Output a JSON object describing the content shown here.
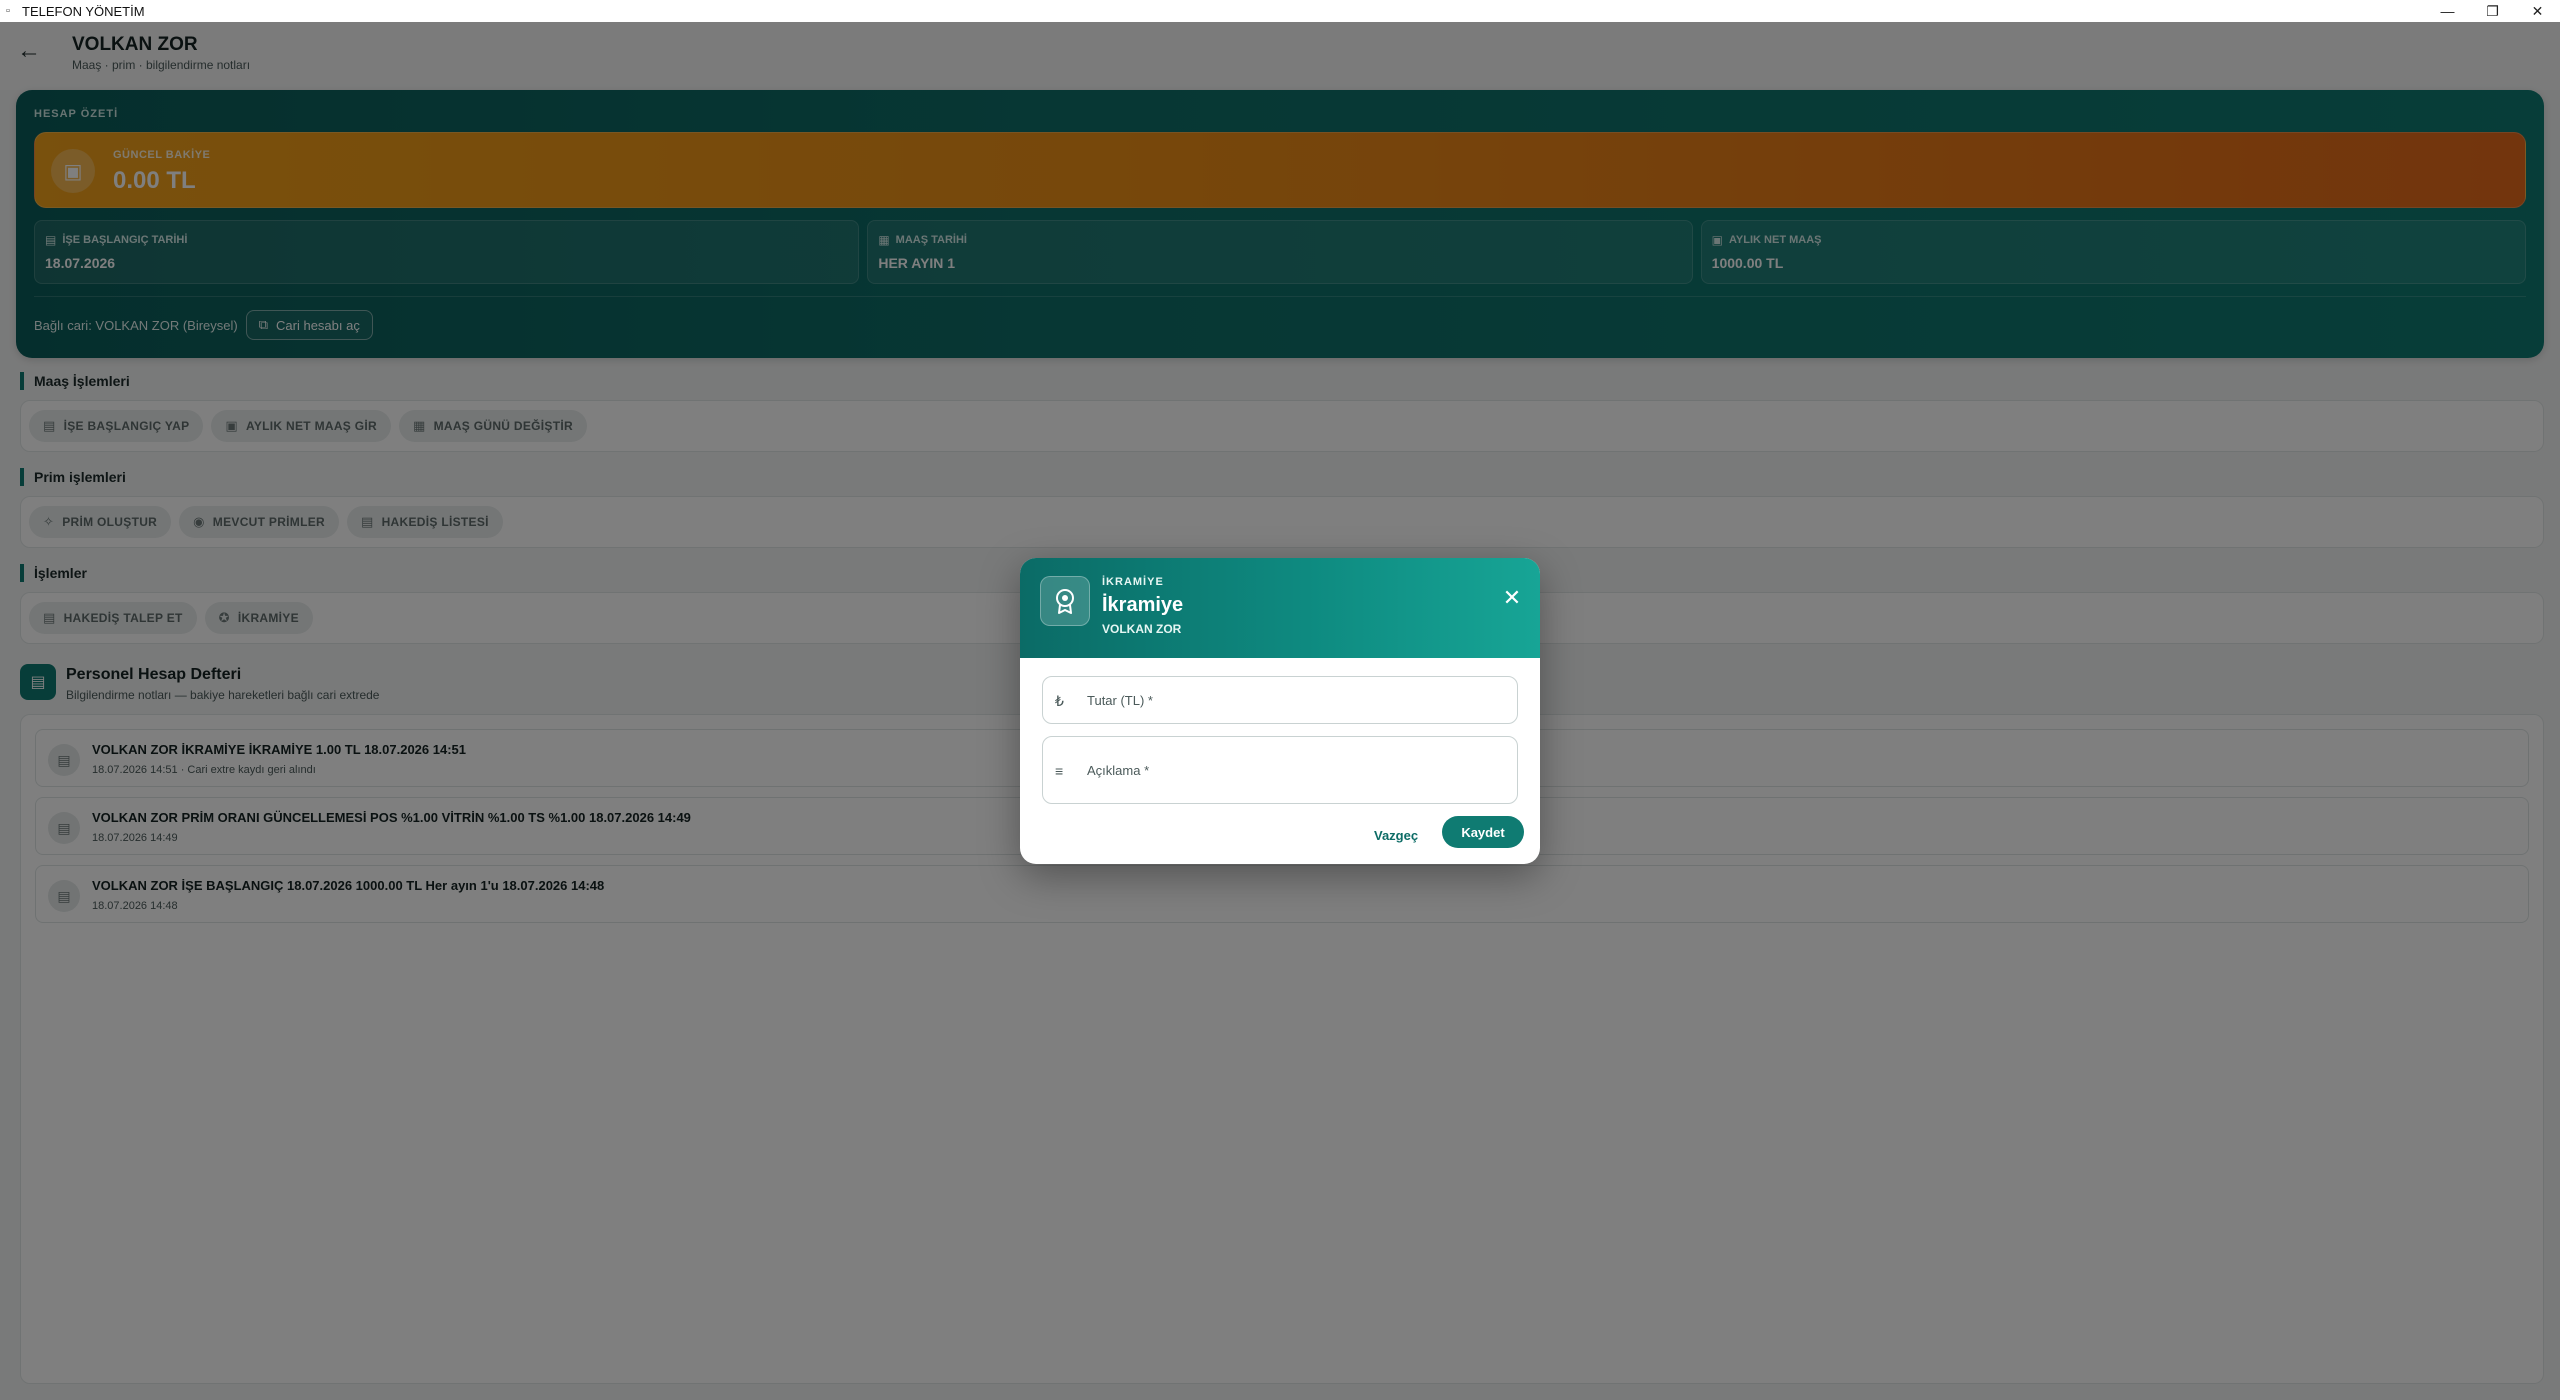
{
  "window": {
    "title": "TELEFON YÖNETİM",
    "controls": {
      "minimize": "—",
      "restore": "❐",
      "close": "✕"
    }
  },
  "header": {
    "back_icon": "←",
    "title": "VOLKAN ZOR",
    "subtitle": "Maaş · prim · bilgilendirme notları"
  },
  "summary": {
    "label": "HESAP ÖZETİ",
    "balance": {
      "icon": "▣",
      "label": "GÜNCEL BAKİYE",
      "value": "0.00 TL"
    },
    "cards": [
      {
        "icon": "▤",
        "label": "İŞE BAŞLANGIÇ TARİHİ",
        "value": "18.07.2026"
      },
      {
        "icon": "▦",
        "label": "MAAŞ TARİHİ",
        "value": "HER AYIN 1"
      },
      {
        "icon": "▣",
        "label": "AYLIK NET MAAŞ",
        "value": "1000.00 TL"
      }
    ],
    "linked_text": "Bağlı cari: VOLKAN ZOR (Bireysel)",
    "open_button": {
      "icon": "⧉",
      "label": "Cari hesabı aç"
    }
  },
  "sections": {
    "salary": {
      "title": "Maaş İşlemleri",
      "chips": [
        {
          "icon": "▤",
          "label": "İŞE BAŞLANGIÇ YAP"
        },
        {
          "icon": "▣",
          "label": "AYLIK NET MAAŞ GİR"
        },
        {
          "icon": "▦",
          "label": "MAAŞ GÜNÜ DEĞİŞTİR"
        }
      ]
    },
    "bonus": {
      "title": "Prim işlemleri",
      "chips": [
        {
          "icon": "✧",
          "label": "PRİM OLUŞTUR"
        },
        {
          "icon": "◉",
          "label": "MEVCUT PRİMLER"
        },
        {
          "icon": "▤",
          "label": "HAKEDİŞ LİSTESİ"
        }
      ]
    },
    "operations": {
      "title": "İşlemler",
      "chips": [
        {
          "icon": "▤",
          "label": "HAKEDİŞ TALEP ET"
        },
        {
          "icon": "✪",
          "label": "İKRAMİYE"
        }
      ]
    }
  },
  "ledger": {
    "icon": "▤",
    "title": "Personel Hesap Defteri",
    "subtitle": "Bilgilendirme notları — bakiye hareketleri bağlı cari extrede",
    "entries": [
      {
        "icon": "▤",
        "title": "VOLKAN ZOR İKRAMİYE İKRAMİYE 1.00 TL 18.07.2026 14:51",
        "sub": "18.07.2026 14:51 · Cari extre kaydı geri alındı"
      },
      {
        "icon": "▤",
        "title": "VOLKAN ZOR PRİM ORANI GÜNCELLEMESİ POS %1.00 VİTRİN %1.00 TS %1.00 18.07.2026 14:49",
        "sub": "18.07.2026 14:49"
      },
      {
        "icon": "▤",
        "title": "VOLKAN ZOR İŞE BAŞLANGIÇ 18.07.2026 1000.00 TL Her ayın 1'u 18.07.2026 14:48",
        "sub": "18.07.2026 14:48"
      }
    ]
  },
  "dialog": {
    "icon": "award-icon",
    "kicker": "İKRAMİYE",
    "title": "İkramiye",
    "name": "VOLKAN ZOR",
    "close_icon": "✕",
    "amount": {
      "icon": "₺",
      "placeholder": "Tutar (TL) *"
    },
    "description": {
      "icon": "≡",
      "placeholder": "Açıklama *"
    },
    "cancel_label": "Vazgeç",
    "save_label": "Kaydet"
  },
  "colors": {
    "primary": "#0f7b72",
    "balance_gradient_start": "#f3a21a",
    "balance_gradient_end": "#e66a1a",
    "scrim": "rgba(0,0,0,0.5)"
  }
}
